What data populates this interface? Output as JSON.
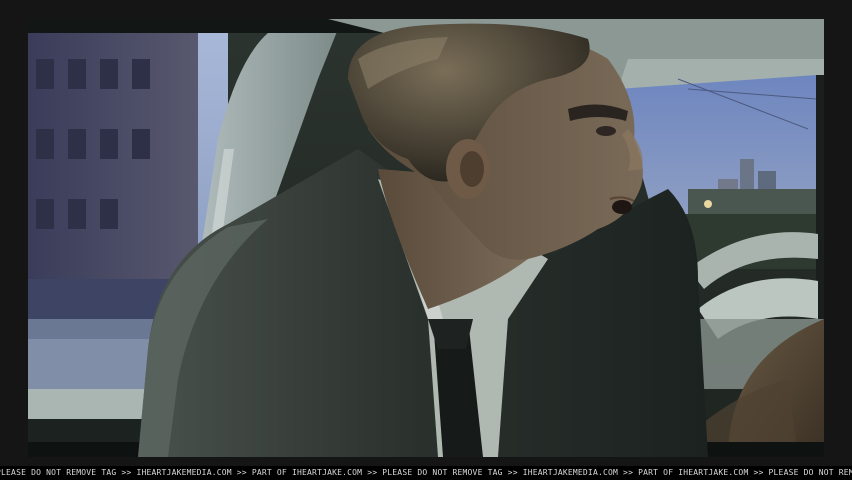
{
  "watermark": {
    "text": "PLEASE DO NOT REMOVE TAG >> IHEARTJAKEMEDIA.COM >> PART OF IHEARTJAKE.COM >> PLEASE DO NOT REMOVE TAG >> IHEARTJAKEMEDIA.COM >> PART OF IHEARTJAKE.COM >> PLEASE DO NOT REMOVE TAG >> IHEARTJAKE"
  },
  "colors": {
    "sky": "#8aa0c8",
    "building_left": "#4a4a66",
    "car_interior": "#9aa8a0",
    "suit": "#2a302c",
    "skin": "#6a5a48",
    "tag_text": "#d8d8d8"
  }
}
